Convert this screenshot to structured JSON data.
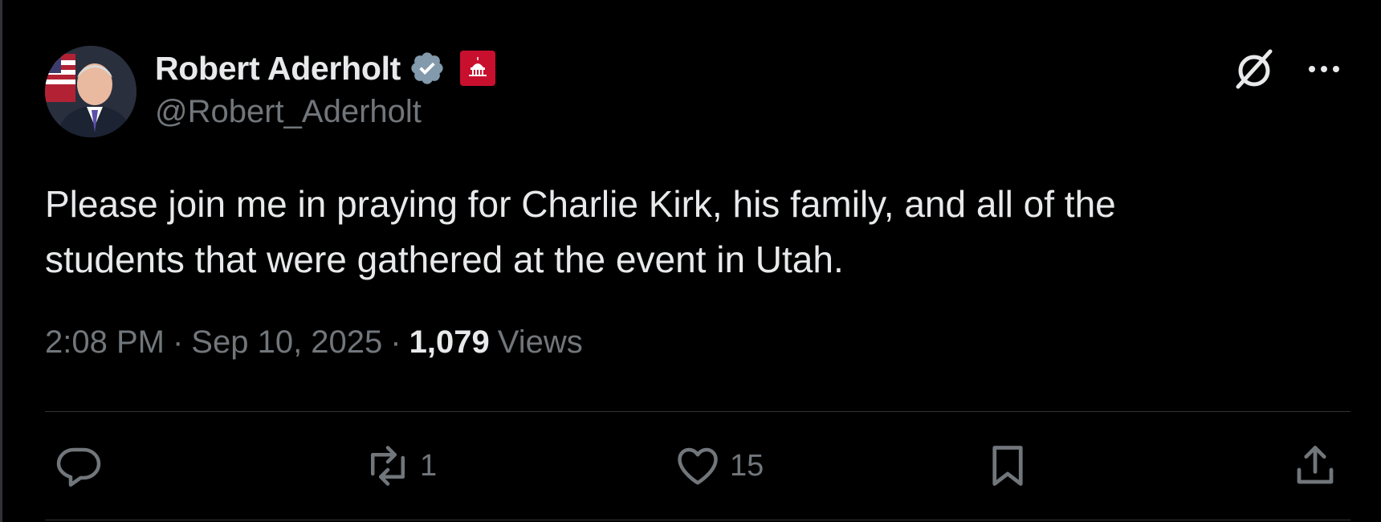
{
  "author": {
    "display_name": "Robert Aderholt",
    "handle": "@Robert_Aderholt",
    "verified": true,
    "avatar_icon": "profile-photo",
    "badge_icon": "capitol-gop-badge",
    "colors": {
      "verified": "#829aab",
      "badge": "#c8102e"
    }
  },
  "tweet": {
    "text": "Please join me in praying for Charlie Kirk, his family, and all of the\nstudents that were gathered at the event in Utah.",
    "time": "2:08 PM",
    "separator": "·",
    "date": "Sep 10, 2025",
    "views_count": "1,079",
    "views_label": "Views"
  },
  "top_actions": {
    "grok_icon": "grok-icon",
    "more_icon": "more-icon"
  },
  "actions": {
    "reply": {
      "icon": "reply-icon",
      "count": ""
    },
    "repost": {
      "icon": "repost-icon",
      "count": "1"
    },
    "like": {
      "icon": "heart-icon",
      "count": "15"
    },
    "bookmark": {
      "icon": "bookmark-icon",
      "count": ""
    },
    "share": {
      "icon": "share-icon",
      "count": ""
    }
  },
  "theme": {
    "background": "#000000",
    "text_primary": "#e7e9ea",
    "text_secondary": "#71767b",
    "border": "#2f3336"
  }
}
